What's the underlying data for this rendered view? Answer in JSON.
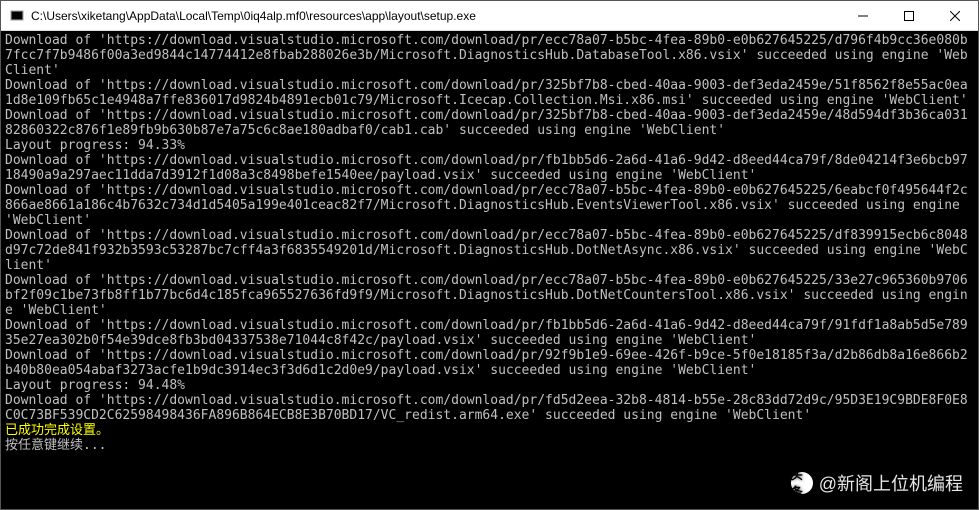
{
  "titlebar": {
    "path": "C:\\Users\\xiketang\\AppData\\Local\\Temp\\0iq4alp.mf0\\resources\\app\\layout\\setup.exe",
    "minimize_label": "Minimize",
    "maximize_label": "Maximize",
    "close_label": "Close"
  },
  "console": {
    "lines": [
      {
        "text": "Download of 'https://download.visualstudio.microsoft.com/download/pr/ecc78a07-b5bc-4fea-89b0-e0b627645225/d796f4b9cc36e080b7fcc7f7b9486f00a3ed9844c14774412e8fbab288026e3b/Microsoft.DiagnosticsHub.DatabaseTool.x86.vsix' succeeded using engine 'WebClient'"
      },
      {
        "text": "Download of 'https://download.visualstudio.microsoft.com/download/pr/325bf7b8-cbed-40aa-9003-def3eda2459e/51f8562f8e55ac0ea1d8e109fb65c1e4948a7ffe836017d9824b4891ecb01c79/Microsoft.Icecap.Collection.Msi.x86.msi' succeeded using engine 'WebClient'"
      },
      {
        "text": "Download of 'https://download.visualstudio.microsoft.com/download/pr/325bf7b8-cbed-40aa-9003-def3eda2459e/48d594df3b36ca03182860322c876f1e89fb9b630b87e7a75c6c8ae180adbaf0/cab1.cab' succeeded using engine 'WebClient'"
      },
      {
        "text": "Layout progress: 94.33%"
      },
      {
        "text": "Download of 'https://download.visualstudio.microsoft.com/download/pr/fb1bb5d6-2a6d-41a6-9d42-d8eed44ca79f/8de04214f3e6bcb9718490a9a297aec11dda7d3912f1d08a3c8498befe1540ee/payload.vsix' succeeded using engine 'WebClient'"
      },
      {
        "text": "Download of 'https://download.visualstudio.microsoft.com/download/pr/ecc78a07-b5bc-4fea-89b0-e0b627645225/6eabcf0f495644f2c866ae8661a186c4b7632c734d1d5405a199e401ceac82f7/Microsoft.DiagnosticsHub.EventsViewerTool.x86.vsix' succeeded using engine 'WebClient'"
      },
      {
        "text": "Download of 'https://download.visualstudio.microsoft.com/download/pr/ecc78a07-b5bc-4fea-89b0-e0b627645225/df839915ecb6c8048d97c72de841f932b3593c53287bc7cff4a3f6835549201d/Microsoft.DiagnosticsHub.DotNetAsync.x86.vsix' succeeded using engine 'WebClient'"
      },
      {
        "text": "Download of 'https://download.visualstudio.microsoft.com/download/pr/ecc78a07-b5bc-4fea-89b0-e0b627645225/33e27c965360b9706bf2f09c1be73fb8ff1b77bc6d4c185fca965527636fd9f9/Microsoft.DiagnosticsHub.DotNetCountersTool.x86.vsix' succeeded using engine 'WebClient'"
      },
      {
        "text": "Download of 'https://download.visualstudio.microsoft.com/download/pr/fb1bb5d6-2a6d-41a6-9d42-d8eed44ca79f/91fdf1a8ab5d5e78935e27ea302b0f54e39dce8fb3bd04337538e71044c8f42c/payload.vsix' succeeded using engine 'WebClient'"
      },
      {
        "text": "Download of 'https://download.visualstudio.microsoft.com/download/pr/92f9b1e9-69ee-426f-b9ce-5f0e18185f3a/d2b86db8a16e866b2b40b80ea054abaf3273acfe1b9dc3914ec3f3d6d1c2d0e9/payload.vsix' succeeded using engine 'WebClient'"
      },
      {
        "text": "Layout progress: 94.48%"
      },
      {
        "text": "Download of 'https://download.visualstudio.microsoft.com/download/pr/fd5d2eea-32b8-4814-b55e-28c83dd72d9c/95D3E19C9BDE8F0E8C0C73BF539CD2C62598498436FA896B864ECB8E3B70BD17/VC_redist.arm64.exe' succeeded using engine 'WebClient'"
      },
      {
        "text": "已成功完成设置。",
        "class": "yellow"
      },
      {
        "text": "按任意键继续..."
      }
    ]
  },
  "watermark": {
    "handle": "@新阁上位机编程",
    "icon_glyph": "头条"
  }
}
